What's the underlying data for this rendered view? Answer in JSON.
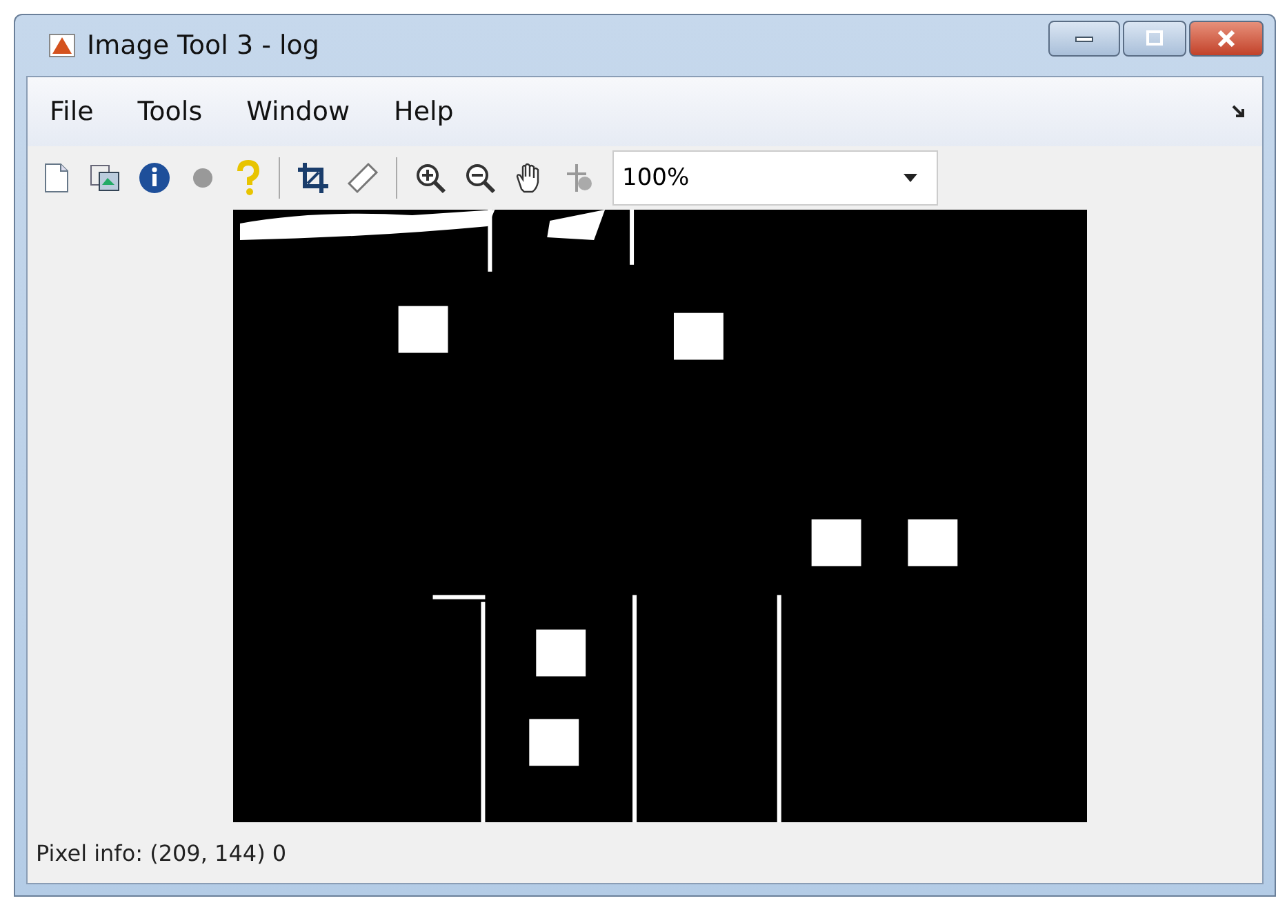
{
  "window": {
    "title": "Image Tool 3 - log"
  },
  "menu": [
    "File",
    "Tools",
    "Window",
    "Help"
  ],
  "toolbar": {
    "zoom": {
      "value": "100%"
    }
  },
  "status_bar": "Pixel info: (209, 144) 0"
}
